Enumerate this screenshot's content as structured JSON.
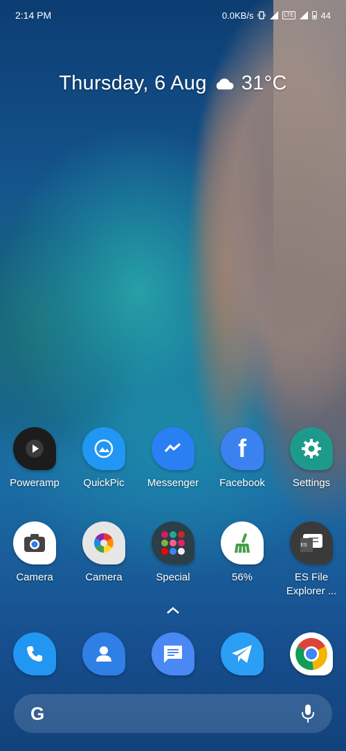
{
  "status_bar": {
    "time": "2:14 PM",
    "net_speed": "0.0KB/s",
    "battery": "44",
    "lte_badge": "LTE",
    "icons": [
      "vibrate-icon",
      "signal-icon",
      "lte-icon",
      "signal-icon",
      "battery-icon"
    ]
  },
  "weather": {
    "date": "Thursday, 6 Aug",
    "temperature": "31°C",
    "icon": "cloud-icon"
  },
  "apps_row1": [
    {
      "label": "Poweramp",
      "icon": "poweramp-icon",
      "color": "#1c1c1c"
    },
    {
      "label": "QuickPic",
      "icon": "quickpic-icon",
      "color": "#2196f3"
    },
    {
      "label": "Messenger",
      "icon": "messenger-icon",
      "color": "#2a7ff3"
    },
    {
      "label": "Facebook",
      "icon": "facebook-icon",
      "color": "#3b82f0"
    },
    {
      "label": "Settings",
      "icon": "settings-icon",
      "color": "#1e9a8c"
    }
  ],
  "apps_row2": [
    {
      "label": "Camera",
      "icon": "camera-icon",
      "color": "#ffffff"
    },
    {
      "label": "Camera",
      "icon": "camera-aperture-icon",
      "color": "#e6e6e6"
    },
    {
      "label": "Special",
      "icon": "folder-icon",
      "color": "#2c3e47"
    },
    {
      "label": "56%",
      "icon": "cleaner-broom-icon",
      "color": "#ffffff"
    },
    {
      "label": "ES File Explorer ...",
      "icon": "es-file-explorer-icon",
      "color": "#3a3a3a"
    }
  ],
  "dock": [
    {
      "icon": "phone-icon",
      "color": "#2196f3"
    },
    {
      "icon": "contacts-icon",
      "color": "#2f7fe6"
    },
    {
      "icon": "messages-icon",
      "color": "#4a88f5"
    },
    {
      "icon": "telegram-icon",
      "color": "#2b9ef5"
    },
    {
      "icon": "chrome-icon",
      "color": "#ffffff"
    }
  ],
  "search": {
    "logo": "G",
    "icons": [
      "google-g-icon",
      "microphone-icon"
    ]
  },
  "es_badge": "ES"
}
